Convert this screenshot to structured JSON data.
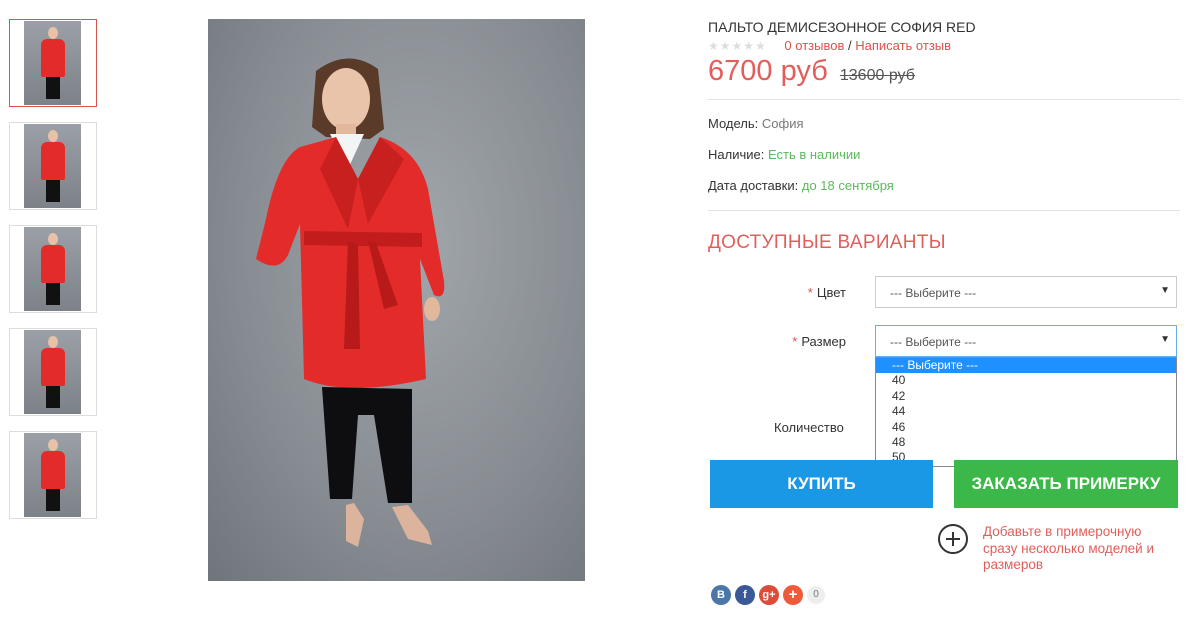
{
  "product": {
    "title": "ПАЛЬТО ДЕМИСЕЗОННОЕ СОФИЯ RED",
    "stars": "★★★★★",
    "reviews_link": "0 отзывов",
    "separator": " / ",
    "write_review_link": "Написать отзыв",
    "price": "6700 руб",
    "old_price": "13600 руб"
  },
  "info": {
    "model_label": "Модель:",
    "model_value": "София",
    "availability_label": "Наличие:",
    "availability_value": "Есть в наличии",
    "delivery_label": "Дата доставки:",
    "delivery_value": "до 18 сентября"
  },
  "variants": {
    "heading": "ДОСТУПНЫЕ ВАРИАНТЫ",
    "required_mark": "*",
    "color_label": "Цвет",
    "color_value": "--- Выберите ---",
    "size_label": "Размер",
    "size_value": "--- Выберите ---",
    "size_options": [
      "--- Выберите ---",
      "40",
      "42",
      "44",
      "46",
      "48",
      "50"
    ],
    "quantity_label": "Количество"
  },
  "buttons": {
    "buy": "КУПИТЬ",
    "fitting": "ЗАКАЗАТЬ ПРИМЕРКУ"
  },
  "fitting_note": "Добавьте в примерочную сразу несколько моделей и размеров",
  "share": {
    "vk": "В",
    "facebook": "f",
    "gplus": "g+",
    "more": "+",
    "count": "0"
  },
  "colors": {
    "accent_red": "#e15e5b",
    "buy_blue": "#1a98e6",
    "fitting_green": "#3cb84a",
    "in_stock_green": "#5cb85c",
    "coat_red": "#e32c2a"
  },
  "icons": {
    "plus": "add-to-fitting-icon",
    "arrow": "chevron-down-icon"
  }
}
